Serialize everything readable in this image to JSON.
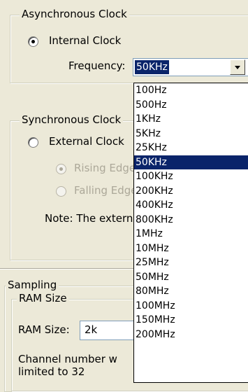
{
  "async_group": {
    "legend": "Asynchronous Clock",
    "internal_clock_label": "Internal Clock",
    "frequency_label": "Frequency:",
    "frequency_value": "50KHz"
  },
  "sync_group": {
    "legend": "Synchronous Clock",
    "external_clock_label": "External Clock",
    "rising_edge_label": "Rising Edge",
    "falling_edge_label": "Falling Edge",
    "note": "Note: The external"
  },
  "sampling_group": {
    "legend": "Sampling",
    "ram_group_legend": "RAM Size",
    "ram_size_label": "RAM Size:",
    "ram_size_value": "2k",
    "channel_note_line1": "Channel number w",
    "channel_note_line2": "limited to 32"
  },
  "frequency_dropdown": {
    "options": [
      "100Hz",
      "500Hz",
      "1KHz",
      "5KHz",
      "25KHz",
      "50KHz",
      "100KHz",
      "200KHz",
      "400KHz",
      "800KHz",
      "1MHz",
      "10MHz",
      "25MHz",
      "50MHz",
      "80MHz",
      "100MHz",
      "150MHz",
      "200MHz"
    ],
    "selected": "50KHz"
  },
  "colors": {
    "window_bg": "#ece9d8",
    "selection_bg": "#0a246a",
    "selection_text": "#ffffff",
    "disabled_text": "#aca899"
  }
}
